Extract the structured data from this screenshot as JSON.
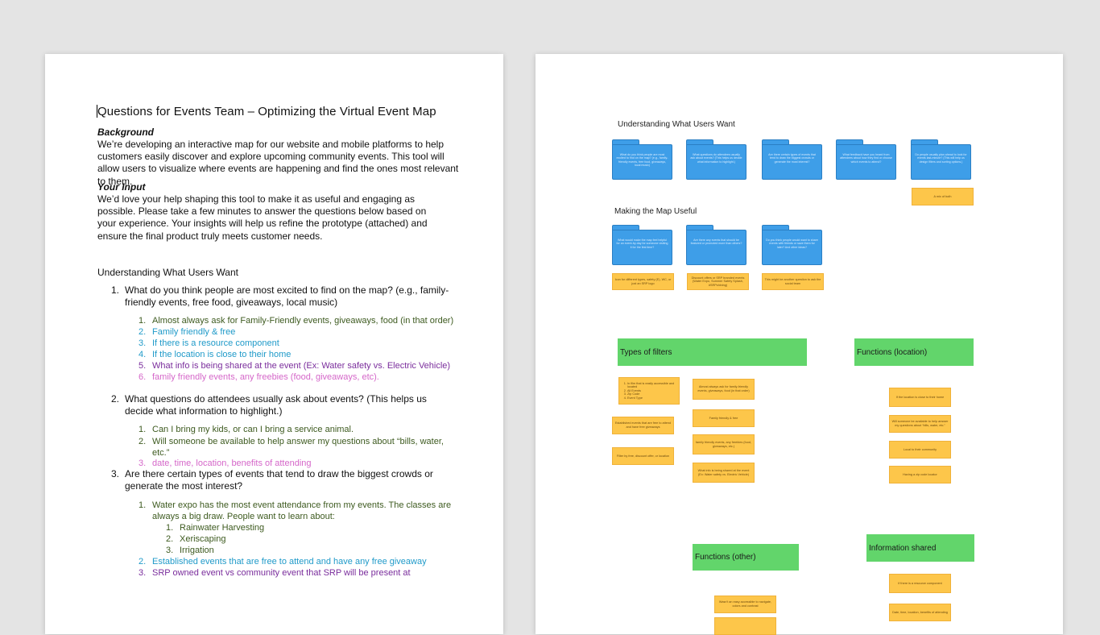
{
  "document": {
    "title": "Questions for Events Team – Optimizing the Virtual Event Map",
    "background_heading": "Background",
    "background_text": "We’re developing an interactive map for our website and mobile platforms to help customers easily discover and explore upcoming community events. This tool will allow users to visualize where events are happening and find the ones most relevant to them.",
    "input_heading": "Your Input",
    "input_text": "We’d love your help shaping this tool to make it as useful and engaging as possible. Please take a few minutes to answer the questions below based on your experience. Your insights will help us refine the prototype (attached) and ensure the final product truly meets customer needs.",
    "section_title": "Understanding What Users Want",
    "questions": [
      {
        "num": "1.",
        "text": "What do you think people are most excited to find on the map? (e.g., family-friendly events, free food, giveaways, local music)",
        "answers": [
          {
            "num": "1.",
            "text": "Almost always ask for Family-Friendly events, giveaways, food (in that order)"
          },
          {
            "num": "2.",
            "text": "Family friendly & free"
          },
          {
            "num": "3.",
            "text": "If there is a resource component"
          },
          {
            "num": "4.",
            "text": "If the location is close to their home"
          },
          {
            "num": "5.",
            "text": "What info is being shared at the event (Ex: Water safety vs. Electric Vehicle)"
          },
          {
            "num": "6.",
            "text": "family friendly events, any freebies (food, giveaways, etc)."
          }
        ]
      },
      {
        "num": "2.",
        "text": "What questions do attendees usually ask about events? (This helps us decide what information to highlight.)",
        "answers": [
          {
            "num": "1.",
            "text": "Can I bring my kids, or can I bring a service animal."
          },
          {
            "num": "2.",
            "text": "Will someone be available to help answer my questions about “bills, water, etc.”"
          },
          {
            "num": "3.",
            "text": "date, time, location, benefits of attending"
          }
        ]
      },
      {
        "num": "3.",
        "text": "Are there certain types of events that tend to draw the biggest crowds or generate the most interest?",
        "answers": [
          {
            "num": "1.",
            "text": "Water expo has the most event attendance from my events. The classes are always a big draw. People want to learn about:"
          },
          {
            "num": "2.",
            "text": "Established events that are free to attend and have any free giveaway"
          },
          {
            "num": "3.",
            "text": "SRP owned event vs community event that SRP will be present at"
          }
        ],
        "subitems": [
          {
            "num": "1.",
            "text": "Rainwater Harvesting"
          },
          {
            "num": "2.",
            "text": "Xeriscaping"
          },
          {
            "num": "3.",
            "text": "Irrigation"
          }
        ]
      }
    ]
  },
  "board": {
    "section1_title": "Understanding What Users Want",
    "section1_folders": [
      "What do you think people are most excited to find on the map? (e.g., family-friendly events, free food, giveaways, local music)",
      "What questions do attendees usually ask about events? (This helps us decide what information to highlight.)",
      "Are there certain types of events that tend to draw the biggest crowds or generate the most interest?",
      "What feedback have you heard from attendees about how they find or choose which events to attend?",
      "Do people usually plan ahead to look for events last-minute? (This will help us design filters and sorting options.)"
    ],
    "section1_note": "A mix of both",
    "section2_title": "Making the Map Useful",
    "section2_folders": [
      "What would make the map feel helpful for an event-by-day for someone visiting it for the first time?",
      "Are there any events that should be featured or promoted more than others?",
      "Do you think people would want to share events with friends or save them for later? And other ideas?"
    ],
    "section2_notes": [
      "Icon for different types, safety (E), WC, or just an SRP logo",
      "Discount offers or SRP branded events (Water Expo, Summer Safety Splash, #SRPshining)",
      "This might be another question to ask the social team"
    ],
    "filters_title": "Types of filters",
    "filters_list": [
      "In film that is easily accessible and located",
      "All Events",
      "Zip Code",
      "Event Type"
    ],
    "filters_notes_left": [
      "Established events that are free to attend and have free giveaways",
      "Filter by free, discount offer, or location"
    ],
    "filters_notes_right": [
      "Almost always ask for family-friendly events, giveaways, food (in that order)",
      "Family friendly & free",
      "family friendly events, any freebies (food, giveaways, etc.)",
      "What info is being shared at the event (Ex: Water safety vs. Electric Vehicle)"
    ],
    "location_title": "Functions (location)",
    "location_notes": [
      "If the location is close to their home",
      "Will someone be available to help answer my questions about “bills, water, etc.”",
      "Local to their community",
      "Having a zip code locator"
    ],
    "other_title": "Functions (other)",
    "other_notes": [
      "Wasn't an easy accessible to navigate, colors and contrast"
    ],
    "info_title": "Information shared",
    "info_notes": [
      "If there is a resource component",
      "Date, time, location, benefits of attending"
    ]
  },
  "colors": {
    "answer_green": "#3d5a1f",
    "answer_blue": "#1f9ac9",
    "answer_purple": "#7a2d9c",
    "answer_pink": "#d567c9",
    "folder_blue": "#3e9ee8",
    "sticky_yellow": "#fdc64a",
    "header_green": "#62d56b"
  }
}
